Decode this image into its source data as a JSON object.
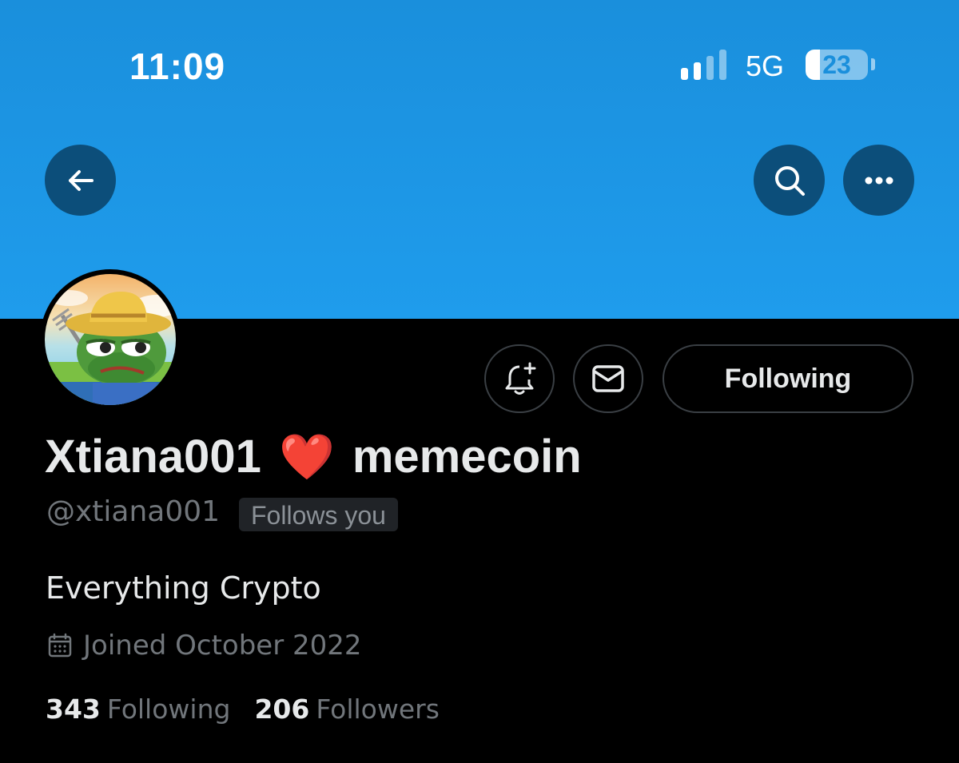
{
  "status_bar": {
    "time": "11:09",
    "network": "5G",
    "battery_level": "23",
    "battery_fraction": 0.23,
    "signal_bars_active": 2,
    "signal_bars_total": 4
  },
  "header": {
    "back_icon": "arrow-left-icon",
    "search_icon": "search-icon",
    "more_icon": "more-horizontal-icon",
    "banner_color": "#1f9cec"
  },
  "profile": {
    "display_name": "Xtiana001",
    "name_emoji": "❤️",
    "name_suffix": "memecoin",
    "handle": "@xtiana001",
    "follows_you_label": "Follows you",
    "bio": "Everything Crypto",
    "joined": "Joined October 2022",
    "avatar": "pepe-frog-farmer-avatar"
  },
  "actions": {
    "notify_icon": "bell-plus-icon",
    "message_icon": "mail-icon",
    "following_label": "Following"
  },
  "stats": {
    "following_count": "343",
    "following_label": "Following",
    "followers_count": "206",
    "followers_label": "Followers"
  },
  "colors": {
    "background": "#000000",
    "text_primary": "#e7e9ea",
    "text_secondary": "#71767b",
    "heart": "#e0142b"
  }
}
